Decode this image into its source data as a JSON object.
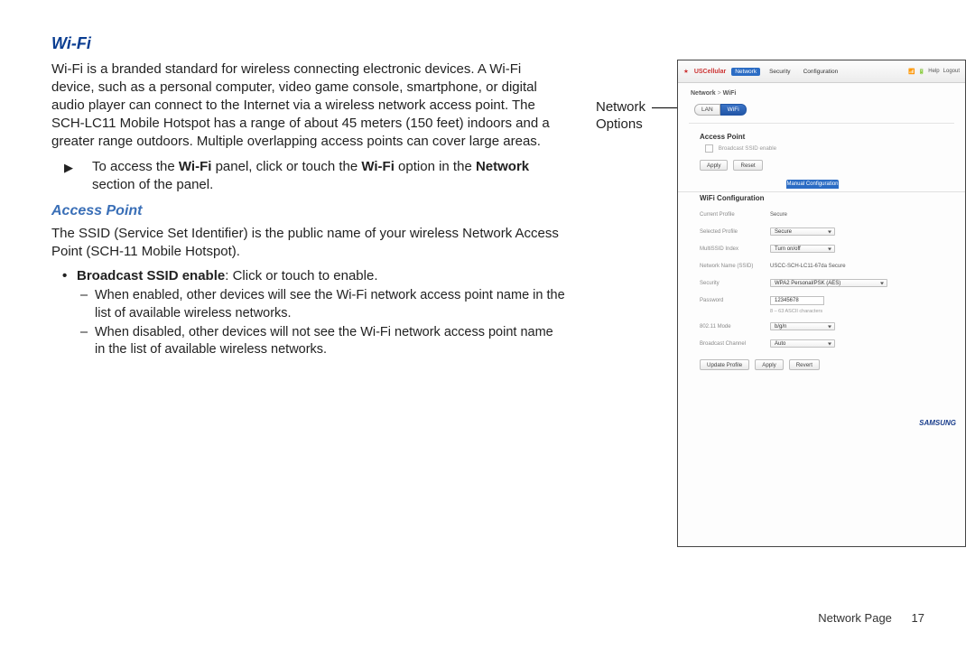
{
  "heading_wifi": "Wi-Fi",
  "wifi_body_1a": "Wi-Fi is a branded standard for wireless connecting electronic devices. A Wi-Fi device, such as a personal computer, video game console, smartphone, or digital audio player can connect to the Internet via a wireless network access point. The SCH-LC11 Mobile Hotspot has a range of about 45 meters (150 feet) indoors and a greater range outdoors. Multiple overlapping access points can cover large areas.",
  "wifi_step_prefix": "To access the ",
  "wifi_step_bold1": "Wi-Fi",
  "wifi_step_mid": " panel, click or touch the ",
  "wifi_step_bold2": "Wi-Fi",
  "wifi_step_suffix1": " option in the ",
  "wifi_step_bold3": "Network",
  "wifi_step_suffix2": " section of the panel.",
  "heading_access_point": "Access Point",
  "ap_body": "The SSID (Service Set Identifier) is the public name of your wireless Network Access Point (SCH-11 Mobile Hotspot).",
  "ap_bullet_bold": "Broadcast SSID enable",
  "ap_bullet_rest": ": Click or touch to enable.",
  "ap_dash_enabled": "When enabled, other devices will see the Wi-Fi network access point name in the list of available wireless networks.",
  "ap_dash_disabled": "When disabled, other devices will not see the Wi-Fi network access point name in the list of available wireless networks.",
  "callout_line1": "Network",
  "callout_line2": "Options",
  "panel": {
    "brand": "USCellular",
    "tabs": {
      "network": "Network",
      "security": "Security",
      "configuration": "Configuration"
    },
    "right": {
      "help": "Help",
      "logout": "Logout"
    },
    "breadcrumb_a": "Network",
    "breadcrumb_b": "WiFi",
    "toggle_lan": "LAN",
    "toggle_wifi": "WiFi",
    "section_access_point": "Access Point",
    "ap_checkbox_label": "Broadcast SSID enable",
    "btn_apply": "Apply",
    "btn_reset": "Reset",
    "tab_chip": "Manual Configuration",
    "section_wifi_config": "WiFi Configuration",
    "rows": {
      "current_profile_label": "Current Profile",
      "current_profile_value": "Secure",
      "selected_profile_label": "Selected Profile",
      "selected_profile_value": "Secure",
      "multissid_label": "MultiSSID Index",
      "multissid_value": "Turn on/off",
      "ssid_label": "Network Name (SSID)",
      "ssid_value": "USCC-SCH-LC11-67da Secure",
      "security_label": "Security",
      "security_value": "WPA2 Personal/PSK (AES)",
      "password_label": "Password",
      "password_value": "12345678",
      "password_hint": "8 – 63 ASCII characters",
      "mode_label": "802.11 Mode",
      "mode_value": "b/g/n",
      "channel_label": "Broadcast Channel",
      "channel_value": "Auto"
    },
    "bottom_btns": {
      "update": "Update Profile",
      "apply": "Apply",
      "revert": "Revert"
    },
    "logo": "SAMSUNG"
  },
  "footer_label": "Network Page",
  "footer_num": "17"
}
